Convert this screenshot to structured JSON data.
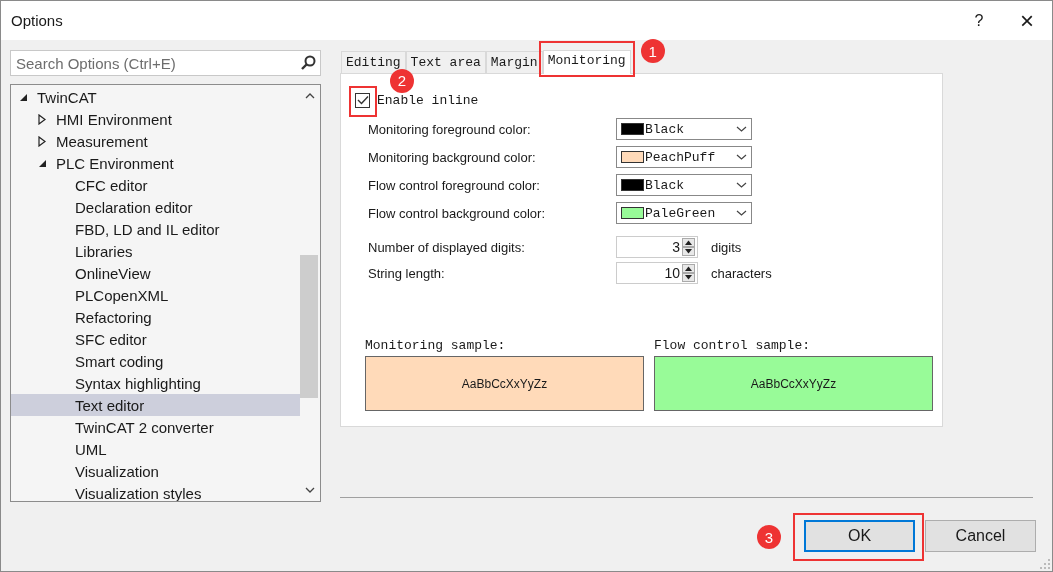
{
  "window": {
    "title": "Options",
    "help": "?",
    "close": "×"
  },
  "search": {
    "placeholder": "Search Options (Ctrl+E)"
  },
  "tree": [
    {
      "label": "TwinCAT",
      "expanded": true,
      "selected": false,
      "children": [
        {
          "label": "HMI Environment",
          "expanded": false,
          "selected": false
        },
        {
          "label": "Measurement",
          "expanded": false,
          "selected": false
        },
        {
          "label": "PLC Environment",
          "expanded": true,
          "selected": false,
          "children": [
            {
              "label": "CFC editor",
              "selected": false
            },
            {
              "label": "Declaration editor",
              "selected": false
            },
            {
              "label": "FBD, LD and IL editor",
              "selected": false
            },
            {
              "label": "Libraries",
              "selected": false
            },
            {
              "label": "OnlineView",
              "selected": false
            },
            {
              "label": "PLCopenXML",
              "selected": false
            },
            {
              "label": "Refactoring",
              "selected": false
            },
            {
              "label": "SFC editor",
              "selected": false
            },
            {
              "label": "Smart coding",
              "selected": false
            },
            {
              "label": "Syntax highlighting",
              "selected": false
            },
            {
              "label": "Text editor",
              "selected": true
            },
            {
              "label": "TwinCAT 2 converter",
              "selected": false
            },
            {
              "label": "UML",
              "selected": false
            },
            {
              "label": "Visualization",
              "selected": false
            },
            {
              "label": "Visualization styles",
              "selected": false
            }
          ]
        }
      ]
    }
  ],
  "tabs": [
    {
      "label": "Editing",
      "selected": false
    },
    {
      "label": "Text area",
      "selected": false
    },
    {
      "label": "Margin",
      "selected": false
    },
    {
      "label": "Monitoring",
      "selected": true,
      "callout": "1"
    }
  ],
  "enable_inline": {
    "label": "Enable inline",
    "checked": true,
    "callout": "2"
  },
  "color_settings": [
    {
      "label": "Monitoring foreground color:",
      "value": "Black",
      "color": "#000000"
    },
    {
      "label": "Monitoring background color:",
      "value": "PeachPuff",
      "color": "#ffdab9"
    },
    {
      "label": "Flow control foreground color:",
      "value": "Black",
      "color": "#000000"
    },
    {
      "label": "Flow control background color:",
      "value": "PaleGreen",
      "color": "#98fb98"
    }
  ],
  "number_settings": [
    {
      "label": "Number of displayed digits:",
      "value": "3",
      "unit": "digits"
    },
    {
      "label": "String length:",
      "value": "10",
      "unit": "characters"
    }
  ],
  "samples": [
    {
      "label": "Monitoring sample:",
      "text": "AaBbCcXxYyZz",
      "color": "#ffdab9"
    },
    {
      "label": "Flow control sample:",
      "text": "AaBbCcXxYyZz",
      "color": "#98fb98"
    }
  ],
  "buttons": [
    {
      "label": "OK",
      "default": true,
      "callout": "3"
    },
    {
      "label": "Cancel",
      "default": false
    }
  ]
}
